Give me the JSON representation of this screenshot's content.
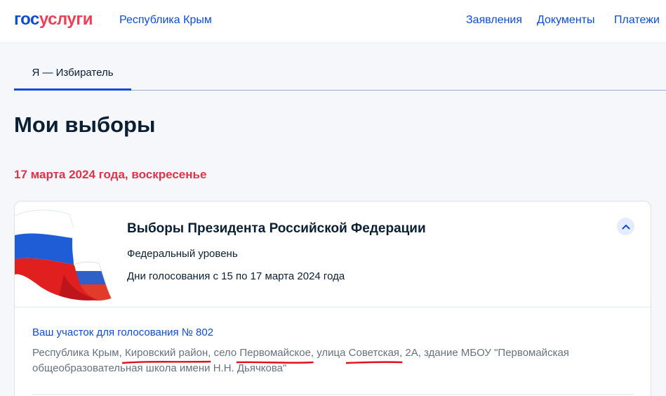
{
  "header": {
    "logo_part1": "гос",
    "logo_part2": "услуги",
    "region": "Республика Крым",
    "nav": [
      "Заявления",
      "Документы",
      "Платежи"
    ]
  },
  "tabs": {
    "active": "Я — Избиратель"
  },
  "page": {
    "title": "Мои выборы",
    "date": "17 марта 2024 года, воскресенье"
  },
  "election": {
    "title": "Выборы Президента Российской Федерации",
    "level": "Федеральный уровень",
    "days": "Дни голосования с 15 по 17 марта 2024 года",
    "station_label": "Ваш участок для голосования № 802",
    "address": {
      "p1": "Республика Крым, ",
      "district": "Кировский район",
      "p2": ", село ",
      "village": "Первомайское",
      "p3": ", улица ",
      "street": "Советская",
      "p4": ", 2А, здание МБОУ \"Первомайская общеобразовательная школа имени Н.Н. Дьячкова\""
    }
  },
  "colors": {
    "brand_blue": "#0d4cd3",
    "brand_red": "#ee3f58",
    "date_red": "#e1324c",
    "annotation_red": "#e0101c"
  },
  "icons": [
    "russian-flag-icon",
    "chevron-up-icon"
  ]
}
